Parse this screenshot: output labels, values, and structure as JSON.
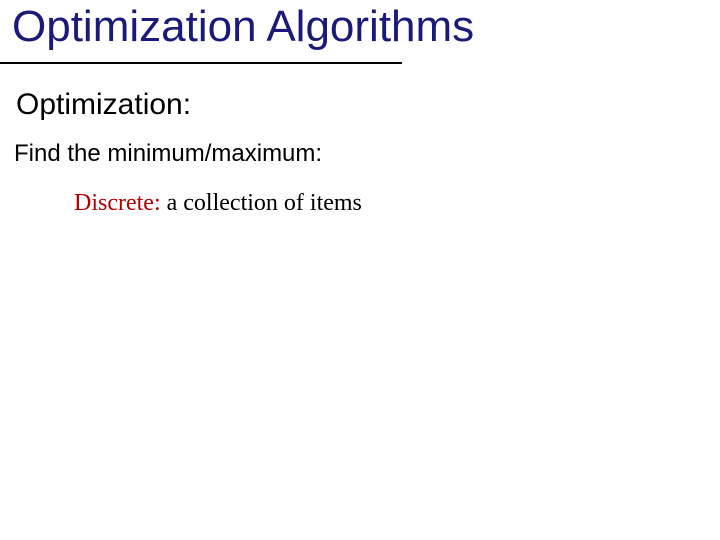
{
  "title": "Optimization Algorithms",
  "subtitle": "Optimization:",
  "body": "Find the minimum/maximum:",
  "discrete": {
    "label": "Discrete:",
    "text": " a collection of items"
  }
}
